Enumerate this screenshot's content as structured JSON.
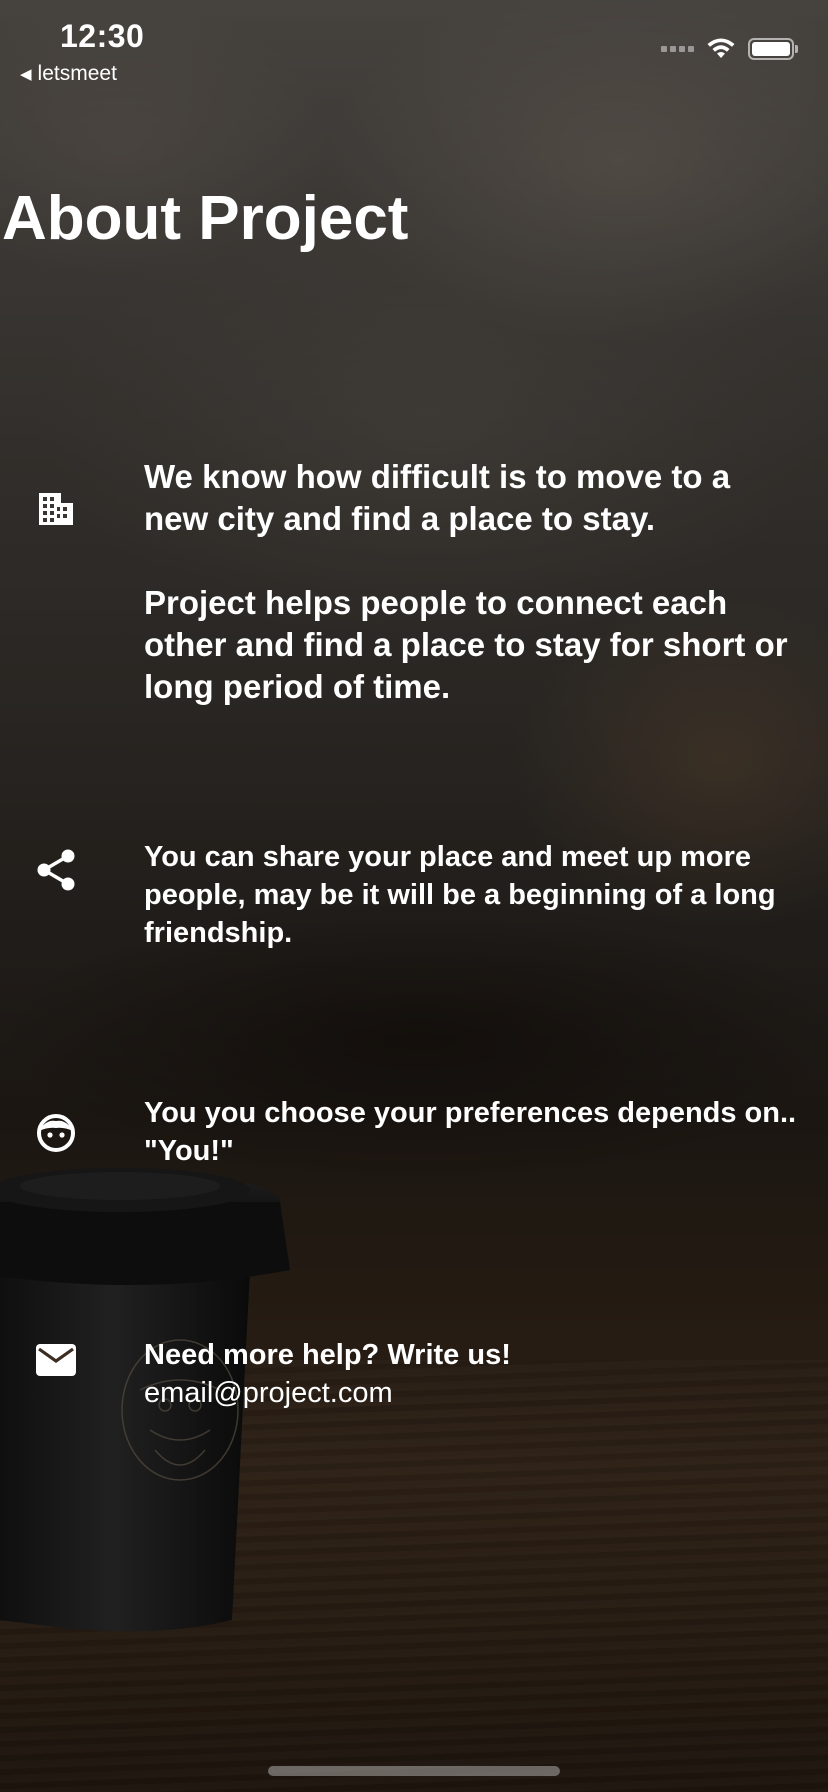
{
  "status_bar": {
    "time": "12:30",
    "back_app": "letsmeet"
  },
  "page": {
    "title": "About Project"
  },
  "sections": [
    {
      "icon": "building-icon",
      "paragraphs": [
        "We know how difficult is to move to a new city and find a place to stay.",
        "Project helps people to connect each other and find a place to stay for short or long period of time."
      ]
    },
    {
      "icon": "share-icon",
      "text": "You can share your place and meet up more people, may be it will be a beginning of a long friendship."
    },
    {
      "icon": "face-icon",
      "text": "You you choose your preferences depends on..  \"You!\""
    },
    {
      "icon": "mail-icon",
      "title": "Need more help? Write us!",
      "email": "email@project.com"
    }
  ]
}
